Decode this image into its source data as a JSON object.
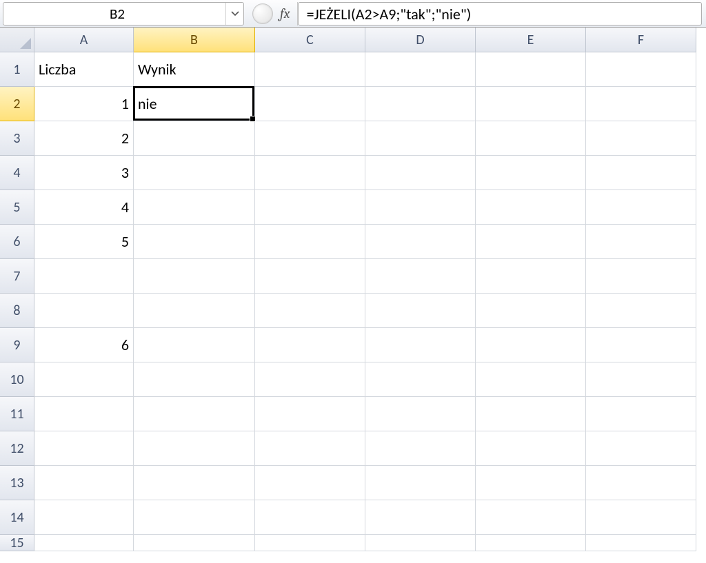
{
  "formulaBar": {
    "nameBox": "B2",
    "fxLabel": "fx",
    "formula": "=JEŻELI(A2>A9;\"tak\";\"nie\")"
  },
  "columns": [
    "A",
    "B",
    "C",
    "D",
    "E",
    "F"
  ],
  "rows": [
    "1",
    "2",
    "3",
    "4",
    "5",
    "6",
    "7",
    "8",
    "9",
    "10",
    "11",
    "12",
    "13",
    "14",
    "15"
  ],
  "activeCell": {
    "col": "B",
    "row": "2"
  },
  "cells": {
    "A1": {
      "v": "Liczba",
      "t": "txt"
    },
    "B1": {
      "v": "Wynik",
      "t": "txt"
    },
    "A2": {
      "v": "1",
      "t": "num"
    },
    "B2": {
      "v": "nie",
      "t": "txt"
    },
    "A3": {
      "v": "2",
      "t": "num"
    },
    "A4": {
      "v": "3",
      "t": "num"
    },
    "A5": {
      "v": "4",
      "t": "num"
    },
    "A6": {
      "v": "5",
      "t": "num"
    },
    "A9": {
      "v": "6",
      "t": "num"
    }
  }
}
